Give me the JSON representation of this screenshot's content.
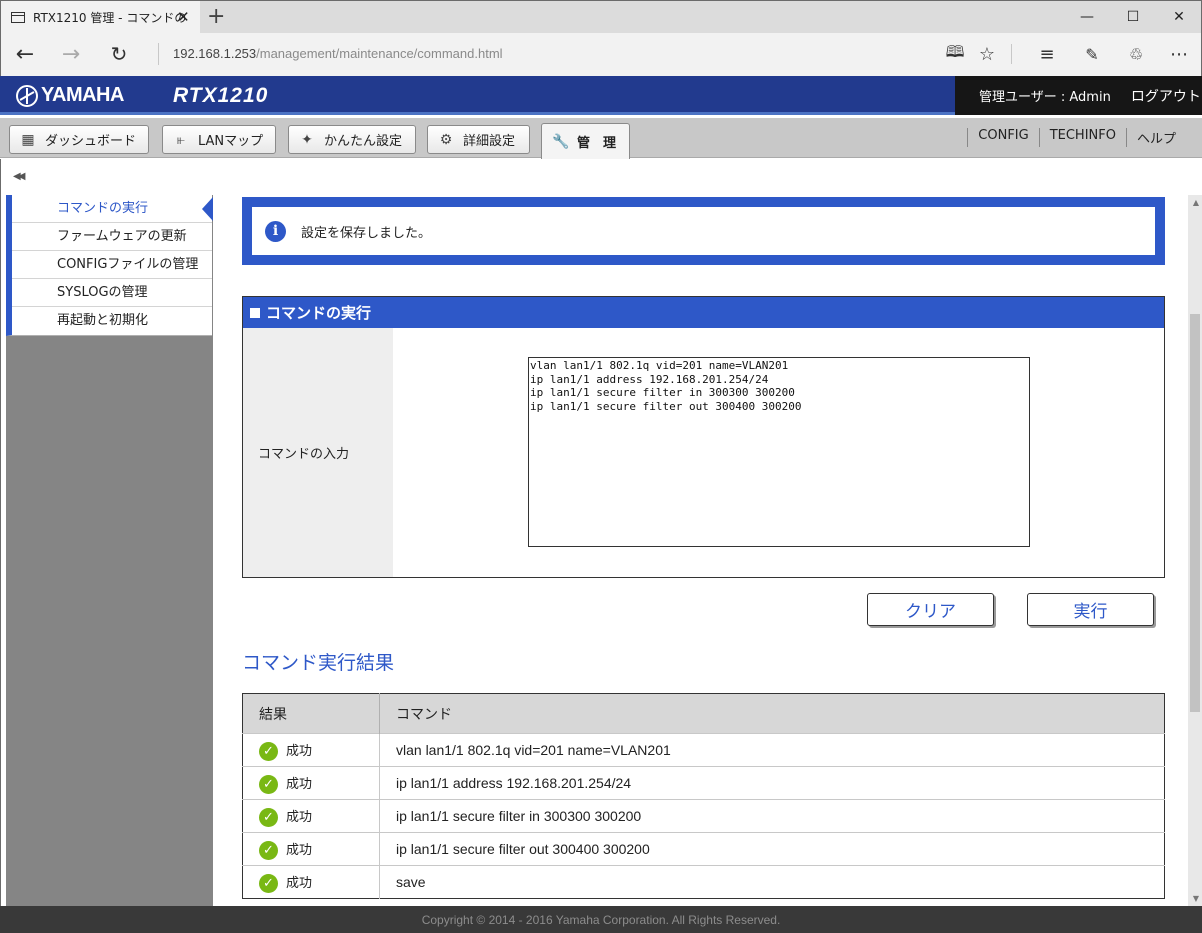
{
  "browser": {
    "tab_title": "RTX1210 管理 - コマンドの",
    "tab_close": "✕",
    "new_tab": "+",
    "url_host": "192.168.1.253",
    "url_path": "/management/maintenance/command.html",
    "icons": [
      "back-arrow-icon",
      "forward-arrow-icon",
      "refresh-icon",
      "reading-view-icon",
      "favorite-star-icon",
      "hub-icon",
      "web-note-icon",
      "share-icon",
      "more-icon"
    ]
  },
  "header": {
    "brand": "YAMAHA",
    "model": "RTX1210",
    "user": "管理ユーザー : Admin",
    "logout": "ログアウト",
    "colors": {
      "header_bg": "#223a8e",
      "accent": "#2e58c8",
      "success": "#79b814"
    }
  },
  "menu": {
    "items": [
      {
        "label": "ダッシュボード",
        "icon": "dashboard-icon"
      },
      {
        "label": "LANマップ",
        "icon": "lan-map-icon"
      },
      {
        "label": "かんたん設定",
        "icon": "wizard-icon"
      },
      {
        "label": "詳細設定",
        "icon": "gear-icon"
      },
      {
        "label": "管　理",
        "icon": "wrench-icon",
        "active": true
      }
    ],
    "links": [
      "CONFIG",
      "TECHINFO",
      "ヘルプ"
    ]
  },
  "sidebar": {
    "items": [
      {
        "label": "コマンドの実行",
        "active": true
      },
      {
        "label": "ファームウェアの更新"
      },
      {
        "label": "CONFIGファイルの管理"
      },
      {
        "label": "SYSLOGの管理"
      },
      {
        "label": "再起動と初期化"
      }
    ]
  },
  "notice": {
    "icon": "info-icon",
    "text": "設定を保存しました。"
  },
  "command_panel": {
    "title": "コマンドの実行",
    "input_label": "コマンドの入力",
    "input_value": "vlan lan1/1 802.1q vid=201 name=VLAN201\nip lan1/1 address 192.168.201.254/24\nip lan1/1 secure filter in 300300 300200\nip lan1/1 secure filter out 300400 300200"
  },
  "buttons": {
    "clear": "クリア",
    "execute": "実行"
  },
  "results": {
    "title": "コマンド実行結果",
    "columns": [
      "結果",
      "コマンド"
    ],
    "rows": [
      {
        "status": "成功",
        "command": "vlan lan1/1 802.1q vid=201 name=VLAN201"
      },
      {
        "status": "成功",
        "command": "ip lan1/1 address 192.168.201.254/24"
      },
      {
        "status": "成功",
        "command": "ip lan1/1 secure filter in 300300 300200"
      },
      {
        "status": "成功",
        "command": "ip lan1/1 secure filter out 300400 300200"
      },
      {
        "status": "成功",
        "command": "save"
      }
    ]
  },
  "footer": {
    "copyright": "Copyright © 2014 - 2016 Yamaha Corporation. All Rights Reserved."
  }
}
